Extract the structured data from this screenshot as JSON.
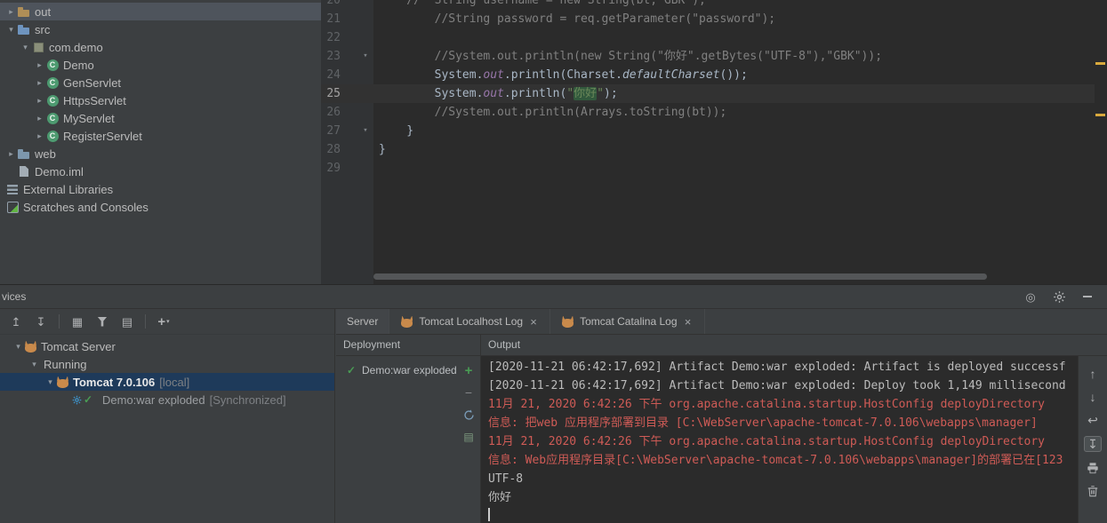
{
  "colors": {
    "panel_bg": "#3c3f41",
    "editor_bg": "#2b2b2b",
    "selection_focused": "#1e3a5a",
    "selection_unfocused": "#4e545c",
    "error_text": "#cf5b56",
    "string_green": "#6a8759",
    "comment_gray": "#808080",
    "code_default": "#a9b7c6",
    "warning_stripe": "#d9a93d"
  },
  "icons": {
    "glyphs": {
      "chevron-down-icon": "▾",
      "chevron-right-icon": "▸",
      "check-icon": "✓",
      "close-icon": "×",
      "scroll-up-icon": "↑",
      "scroll-down-icon": "↓",
      "soft-wrap-icon": "↩",
      "scroll-to-end-icon": "↧",
      "collapse-all-icon": "↥",
      "expand-all-icon": "↧",
      "group-by-icon": "▦",
      "show-options-icon": "▤",
      "add-service-icon": "+",
      "view-options-icon": "◎",
      "deploy-add-icon": "+",
      "undeploy-icon": "−",
      "edit-config-icon": "▤"
    }
  },
  "project_tree": {
    "items": [
      {
        "label": "out",
        "icon": "folder-out",
        "chevron": "right",
        "indent": 0,
        "selected": true
      },
      {
        "label": "src",
        "icon": "folder-src",
        "chevron": "down",
        "indent": 0
      },
      {
        "label": "com.demo",
        "icon": "package",
        "chevron": "down",
        "indent": 1
      },
      {
        "label": "Demo",
        "icon": "class",
        "chevron": "right",
        "indent": 2
      },
      {
        "label": "GenServlet",
        "icon": "class",
        "chevron": "right",
        "indent": 2
      },
      {
        "label": "HttpsServlet",
        "icon": "class",
        "chevron": "right",
        "indent": 2
      },
      {
        "label": "MyServlet",
        "icon": "class",
        "chevron": "right",
        "indent": 2
      },
      {
        "label": "RegisterServlet",
        "icon": "class",
        "chevron": "right",
        "indent": 2
      },
      {
        "label": "web",
        "icon": "folder-web",
        "chevron": "right",
        "indent": 0
      },
      {
        "label": "Demo.iml",
        "icon": "iml-file",
        "chevron": "blank",
        "indent": 0
      },
      {
        "label": "External Libraries",
        "icon": "libraries",
        "chevron": "none",
        "indent": 0
      },
      {
        "label": "Scratches and Consoles",
        "icon": "scratches",
        "chevron": "none",
        "indent": 0
      }
    ]
  },
  "editor": {
    "current_line": 25,
    "lines": [
      {
        "num": "20",
        "segments": [
          {
            "text": "    //  String username = new String(bt,\"GBK\");",
            "style": "comment"
          }
        ]
      },
      {
        "num": "21",
        "segments": [
          {
            "text": "        //String password = req.getParameter(\"password\");",
            "style": "comment"
          }
        ]
      },
      {
        "num": "22",
        "segments": []
      },
      {
        "num": "23",
        "fold": true,
        "segments": [
          {
            "text": "        //System.out.println(new String(\"你好\".getBytes(\"UTF-8\"),\"GBK\"));",
            "style": "comment"
          }
        ]
      },
      {
        "num": "24",
        "segments": [
          {
            "text": "        System.",
            "style": "plain"
          },
          {
            "text": "out",
            "style": "field"
          },
          {
            "text": ".println(Charset.",
            "style": "plain"
          },
          {
            "text": "defaultCharset",
            "style": "static"
          },
          {
            "text": "());",
            "style": "plain"
          }
        ]
      },
      {
        "num": "25",
        "current": true,
        "segments": [
          {
            "text": "        System.",
            "style": "plain"
          },
          {
            "text": "out",
            "style": "field"
          },
          {
            "text": ".println(",
            "style": "plain"
          },
          {
            "text": "\"",
            "style": "string"
          },
          {
            "text": "你好",
            "style": "string-hl"
          },
          {
            "text": "\"",
            "style": "string"
          },
          {
            "text": ");",
            "style": "plain"
          }
        ]
      },
      {
        "num": "26",
        "segments": [
          {
            "text": "        //System.out.println(Arrays.toString(bt));",
            "style": "comment"
          }
        ]
      },
      {
        "num": "27",
        "fold": true,
        "segments": [
          {
            "text": "    }",
            "style": "plain"
          }
        ]
      },
      {
        "num": "28",
        "segments": [
          {
            "text": "}",
            "style": "plain"
          }
        ]
      },
      {
        "num": "29",
        "segments": []
      }
    ]
  },
  "services": {
    "panel_title": "vices",
    "titlebar_icons": [
      "view-options-icon",
      "gear-icon",
      "hide-icon"
    ],
    "toolbar_icons": [
      "collapse-all-icon",
      "expand-all-icon",
      "sep",
      "group-by-icon",
      "filter-icon",
      "show-options-icon",
      "sep",
      "add-service-icon"
    ],
    "tree": [
      {
        "label": "Tomcat Server",
        "suffix": "",
        "icon": "tomcat",
        "chevron": "down",
        "indent": 0
      },
      {
        "label": "Running",
        "suffix": "",
        "icon": null,
        "chevron": "down",
        "indent": 1
      },
      {
        "label": "Tomcat 7.0.106",
        "suffix": "[local]",
        "icon": "tomcat",
        "chevron": "down",
        "indent": 2,
        "selected": true,
        "bold": true
      },
      {
        "label": "Demo:war exploded",
        "suffix": "[Synchronized]",
        "icon": "artifact-sync",
        "chevron": "blank",
        "indent": 3,
        "dim": true
      }
    ],
    "tabs": [
      {
        "label": "Server",
        "icon": null,
        "closable": false,
        "selected": true
      },
      {
        "label": "Tomcat Localhost Log",
        "icon": "tomcat",
        "closable": true,
        "selected": false
      },
      {
        "label": "Tomcat Catalina Log",
        "icon": "tomcat",
        "closable": true,
        "selected": false
      }
    ],
    "deployment": {
      "header": "Deployment",
      "items": [
        {
          "label": "Demo:war exploded",
          "status": "ok"
        }
      ],
      "toolbar_icons": [
        "deploy-add-icon",
        "undeploy-icon",
        "redeploy-icon",
        "edit-config-icon"
      ]
    },
    "output": {
      "header": "Output",
      "toolbar_icons": [
        {
          "name": "scroll-up-icon"
        },
        {
          "name": "scroll-down-icon"
        },
        {
          "name": "soft-wrap-icon"
        },
        {
          "name": "scroll-to-end-icon",
          "selected": true
        },
        {
          "name": "print-icon"
        },
        {
          "name": "clear-icon"
        }
      ],
      "lines": [
        {
          "text": "[2020-11-21 06:42:17,692] Artifact Demo:war exploded: Artifact is deployed successf",
          "style": "plain"
        },
        {
          "text": "[2020-11-21 06:42:17,692] Artifact Demo:war exploded: Deploy took 1,149 millisecond",
          "style": "plain"
        },
        {
          "text": "11月 21, 2020 6:42:26 下午 org.apache.catalina.startup.HostConfig deployDirectory",
          "style": "error"
        },
        {
          "text": "信息: 把web 应用程序部署到目录 [C:\\WebServer\\apache-tomcat-7.0.106\\webapps\\manager]",
          "style": "error"
        },
        {
          "text": "11月 21, 2020 6:42:26 下午 org.apache.catalina.startup.HostConfig deployDirectory",
          "style": "error"
        },
        {
          "text": "信息: Web应用程序目录[C:\\WebServer\\apache-tomcat-7.0.106\\webapps\\manager]的部署已在[123",
          "style": "error"
        },
        {
          "text": "UTF-8",
          "style": "plain"
        },
        {
          "text": "你好",
          "style": "plain"
        }
      ]
    }
  }
}
